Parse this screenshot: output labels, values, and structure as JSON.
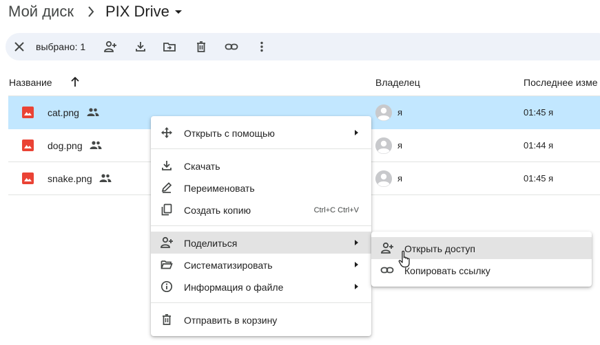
{
  "breadcrumb": {
    "root": "Мой диск",
    "current": "PIX Drive"
  },
  "selection_bar": {
    "count_label": "выбрано: 1"
  },
  "columns": {
    "name": "Название",
    "owner": "Владелец",
    "modified": "Последнее изме"
  },
  "files": [
    {
      "name": "cat.png",
      "owner": "я",
      "modified": "01:45 я",
      "selected": true
    },
    {
      "name": "dog.png",
      "owner": "я",
      "modified": "01:44 я",
      "selected": false
    },
    {
      "name": "snake.png",
      "owner": "я",
      "modified": "01:45 я",
      "selected": false
    }
  ],
  "context_menu": {
    "open_with": "Открыть с помощью",
    "download": "Скачать",
    "rename": "Переименовать",
    "copy": "Создать копию",
    "copy_shortcut": "Ctrl+C Ctrl+V",
    "share": "Поделиться",
    "organize": "Систематизировать",
    "file_info": "Информация о файле",
    "trash": "Отправить в корзину"
  },
  "share_submenu": {
    "open_access": "Открыть доступ",
    "copy_link": "Копировать ссылку"
  },
  "colors": {
    "selected_row": "#c2e7ff",
    "selection_bar": "#eef2f9",
    "image_file_icon": "#ea4335",
    "menu_hover": "#e3e3e3"
  }
}
